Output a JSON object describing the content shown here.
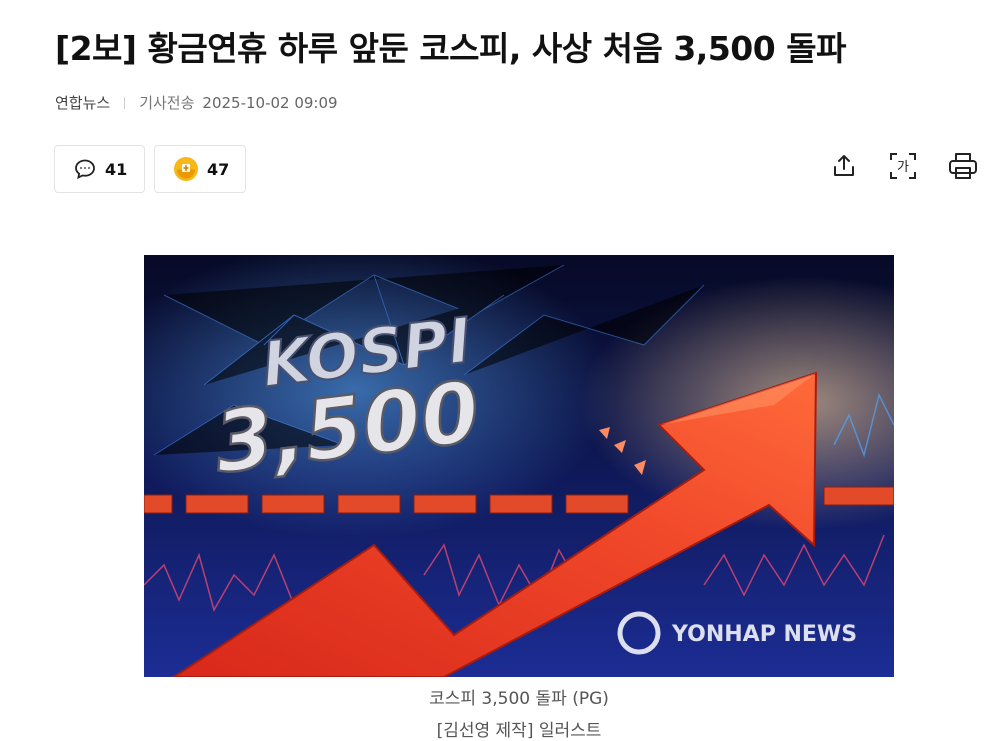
{
  "article": {
    "title": "[2보] 황금연휴 하루 앞둔 코스피, 사상 처음 3,500 돌파",
    "source": "연합뉴스",
    "date_label": "기사전송",
    "date": "2025-10-02 09:09"
  },
  "counters": {
    "comments": "41",
    "reactions": "47"
  },
  "toolbar": {
    "share_icon": "share-icon",
    "font_icon": "font-size-icon",
    "font_glyph": "가",
    "print_icon": "print-icon"
  },
  "image": {
    "headline_line1": "KOSPI",
    "headline_line2": "3,500",
    "watermark": "YONHAP NEWS",
    "colors": {
      "arrow": "#ee4422",
      "bg_top": "#0a0e33",
      "bg_bottom": "#1a2a8a"
    }
  },
  "caption": {
    "line1": "코스피 3,500 돌파 (PG)",
    "line2": "[김선영 제작] 일러스트"
  }
}
